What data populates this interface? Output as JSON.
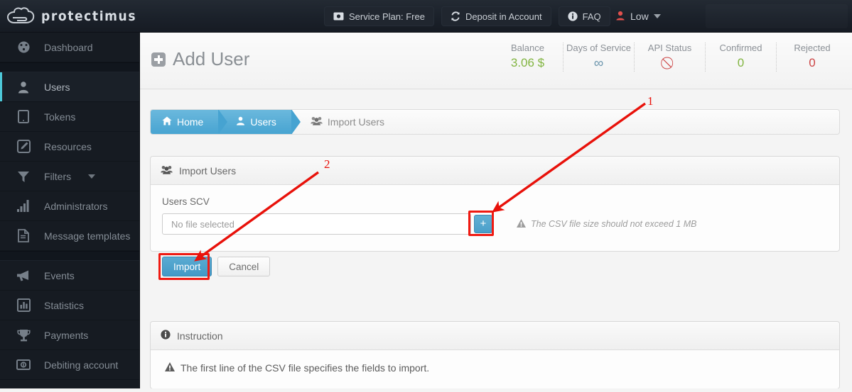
{
  "topbar": {
    "brand": "protectimus",
    "buttons": [
      {
        "label": "Service Plan: Free",
        "icon": "money-icon"
      },
      {
        "label": "Deposit in Account",
        "icon": "refresh-icon"
      },
      {
        "label": "FAQ",
        "icon": "info-icon"
      }
    ],
    "user": {
      "label": "Low",
      "icon": "user-icon",
      "caret": "chevron-down-icon"
    }
  },
  "sidebar": {
    "items": [
      {
        "label": "Dashboard",
        "icon": "dashboard-icon",
        "active": false,
        "group": 0
      },
      {
        "label": "Users",
        "icon": "user-icon",
        "active": true,
        "group": 1
      },
      {
        "label": "Tokens",
        "icon": "tablet-icon",
        "active": false,
        "group": 1
      },
      {
        "label": "Resources",
        "icon": "edit-square-icon",
        "active": false,
        "group": 1
      },
      {
        "label": "Filters",
        "icon": "funnel-icon",
        "active": false,
        "group": 1,
        "caret": true
      },
      {
        "label": "Administrators",
        "icon": "bar-chart-icon",
        "active": false,
        "group": 1
      },
      {
        "label": "Message templates",
        "icon": "document-icon",
        "active": false,
        "group": 1
      },
      {
        "label": "Events",
        "icon": "megaphone-icon",
        "active": false,
        "group": 2
      },
      {
        "label": "Statistics",
        "icon": "chart-box-icon",
        "active": false,
        "group": 2
      },
      {
        "label": "Payments",
        "icon": "trophy-icon",
        "active": false,
        "group": 2
      },
      {
        "label": "Debiting account",
        "icon": "banknote-icon",
        "active": false,
        "group": 2
      }
    ]
  },
  "header": {
    "title": "Add User",
    "title_icon": "plus-square-icon",
    "stats": [
      {
        "key": "Balance",
        "value": "3.06 $",
        "style": "green"
      },
      {
        "key": "Days of Service",
        "value": "∞",
        "style": "blue"
      },
      {
        "key": "API Status",
        "value": "⃠",
        "style": "red"
      },
      {
        "key": "Confirmed",
        "value": "0",
        "style": "green"
      },
      {
        "key": "Rejected",
        "value": "0",
        "style": "red"
      }
    ]
  },
  "breadcrumb": {
    "items": [
      {
        "label": "Home",
        "icon": "home-icon",
        "style": "blue"
      },
      {
        "label": "Users",
        "icon": "user-icon",
        "style": "blue"
      },
      {
        "label": "Import Users",
        "icon": "users-group-icon",
        "style": "plain"
      }
    ]
  },
  "import_panel": {
    "title": "Import Users",
    "title_icon": "users-group-icon",
    "field_label": "Users SCV",
    "file_placeholder": "No file selected",
    "file_value": "",
    "add_button_label": "+",
    "size_hint": "The CSV file size should not exceed 1 MB",
    "size_hint_icon": "warning-icon",
    "import_label": "Import",
    "cancel_label": "Cancel"
  },
  "instruction_panel": {
    "title": "Instruction",
    "title_icon": "info-circle-icon",
    "text": "The first line of the CSV file specifies the fields to import.",
    "text_icon": "warning-icon"
  },
  "annotations": {
    "markers": [
      {
        "number": "1",
        "target": "file-add-button"
      },
      {
        "number": "2",
        "target": "import-button"
      }
    ],
    "color": "#e8110a"
  },
  "colors": {
    "accent_blue": "#46a3d1",
    "annotation_red": "#e8110a",
    "sidebar_bg": "#161b22",
    "active_marker": "#4dc8d8",
    "stat_green": "#82b541",
    "stat_red": "#cc4444"
  }
}
